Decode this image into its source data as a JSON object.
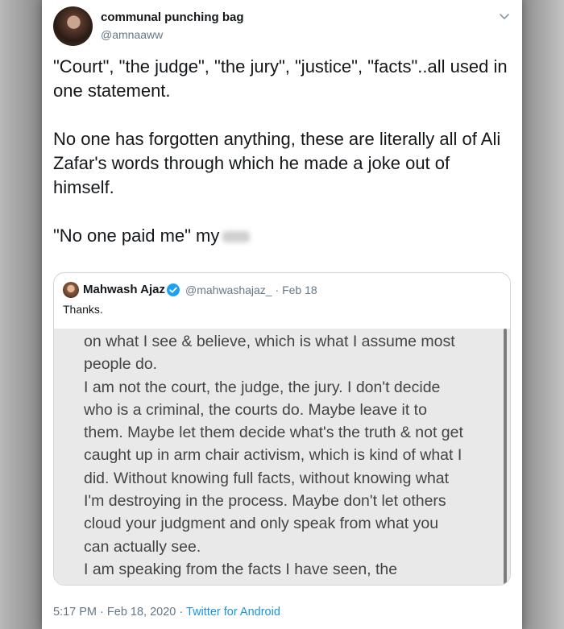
{
  "tweet": {
    "author_name": "communal punching bag",
    "author_handle": "@amnaaww",
    "paragraphs": [
      "\"Court\", \"the judge\", \"the jury\", \"justice\", \"facts\"..all used in one statement.",
      "No one has forgotten anything, these are literally all of Ali Zafar's words through which he made a joke out of himself."
    ],
    "last_line": "\"No one paid me\" my"
  },
  "quoted_tweet": {
    "author_name": "Mahwash Ajaz",
    "author_handle": "@mahwashajaz_",
    "date": "Feb 18",
    "separator": "·",
    "text": "Thanks.",
    "image_lines": [
      "on what I see & believe, which is what I assume most",
      "people do.",
      "I am not the court, the judge, the jury. I don't decide",
      "who is a criminal, the courts do. Maybe leave it to",
      "them. Maybe let them decide what's the truth & not get",
      "caught up in arm chair activism, which is kind of what I",
      "did. Without knowing full facts, without knowing what",
      "I'm destroying in the process. Maybe don't let others",
      "cloud your judgment and only speak from what you",
      "can actually see.",
      "I am speaking from the facts I have seen, the"
    ]
  },
  "footer": {
    "time": "5:17 PM",
    "date": "Feb 18, 2020",
    "separator": "·",
    "client": "Twitter for Android"
  },
  "icons": {
    "more_options": "chevron-down-icon",
    "verified": "verified-badge-icon"
  },
  "colors": {
    "link": "#1b95e0",
    "secondary_text": "#657786",
    "verified": "#1da1f2"
  }
}
